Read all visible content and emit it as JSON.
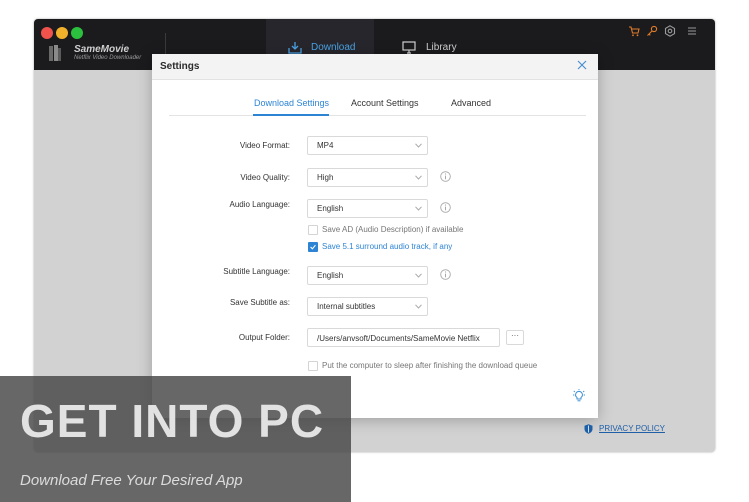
{
  "app": {
    "name": "SameMovie",
    "subtitle": "Netflix Video Downloader"
  },
  "nav": {
    "download": "Download",
    "library": "Library"
  },
  "toolbar_icons": [
    "cart-icon",
    "key-icon",
    "settings-icon",
    "menu-icon"
  ],
  "dialog": {
    "title": "Settings",
    "tabs": [
      "Download Settings",
      "Account Settings",
      "Advanced"
    ],
    "active_tab": "Download Settings",
    "fields": {
      "video_format": {
        "label": "Video Format:",
        "value": "MP4"
      },
      "video_quality": {
        "label": "Video Quality:",
        "value": "High"
      },
      "audio_language": {
        "label": "Audio Language:",
        "value": "English"
      },
      "subtitle_language": {
        "label": "Subtitle Language:",
        "value": "English"
      },
      "save_subtitle_as": {
        "label": "Save Subtitle as:",
        "value": "Internal subtitles"
      },
      "output_folder": {
        "label": "Output Folder:",
        "value": "/Users/anvsoft/Documents/SameMovie Netflix",
        "browse": "···"
      }
    },
    "checkboxes": {
      "save_ad": {
        "label": "Save AD (Audio Description) if available",
        "checked": false
      },
      "save_51": {
        "label": "Save 5.1 surround audio track, if any",
        "checked": true
      },
      "sleep": {
        "label": "Put the computer to sleep after finishing the download queue",
        "checked": false
      }
    }
  },
  "footer": {
    "privacy": "PRIVACY POLICY"
  },
  "watermark": {
    "title": "GET INTO PC",
    "subtitle": "Download Free Your Desired App"
  },
  "colors": {
    "accent": "#2d84d5",
    "topbar": "#1b1b1e",
    "background": "#d2d2d2"
  }
}
